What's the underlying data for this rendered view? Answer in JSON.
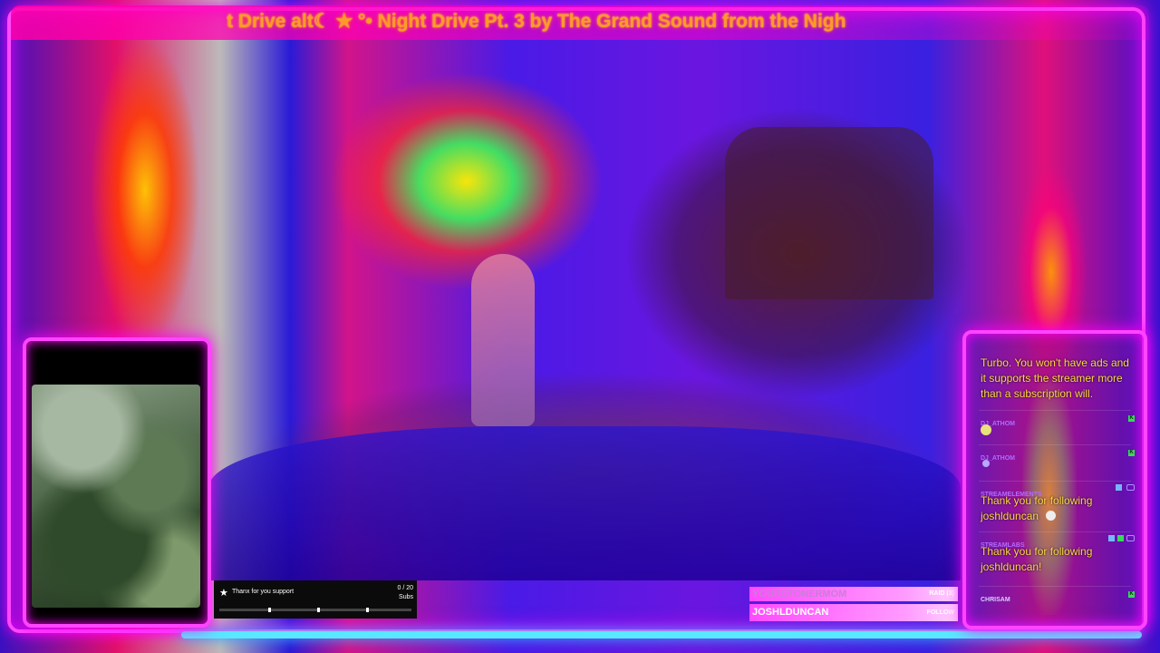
{
  "marquee": {
    "text": "t Drive alt☾ ★ °• Night Drive Pt. 3 by The Grand Sound from the Nigh"
  },
  "sub_goal": {
    "label": "Thanx for you support",
    "count": "0 / 20",
    "unit": "Subs",
    "progress": 0
  },
  "events": [
    {
      "name": "YOURSTONERMOM",
      "type": "RAID (3)"
    },
    {
      "name": "JOSHLDUNCAN",
      "type": "FOLLOW"
    }
  ],
  "chat": {
    "intro_text": "Turbo. You won't have ads and it supports the streamer more than a subscription will.",
    "messages": [
      {
        "user": "DJ_ATHOM",
        "text": "",
        "emote": "smiley-emote"
      },
      {
        "user": "DJ_ATHOM",
        "text": "",
        "emote": "small-emote"
      },
      {
        "user": "STREAMELEMENTS",
        "text": "Thank you for following joshlduncan",
        "emote": "skull-emote"
      },
      {
        "user": "STREAMLABS",
        "text": "Thank you for following joshlduncan!",
        "emote": ""
      },
      {
        "user": "CHRISAM",
        "text": "",
        "emote": ""
      }
    ]
  },
  "colors": {
    "frame_neon": "#ff44ff",
    "bottom_glow": "#58e8ff",
    "chat_text": "#ffd74a",
    "marquee_text": "#ff9a2a"
  }
}
